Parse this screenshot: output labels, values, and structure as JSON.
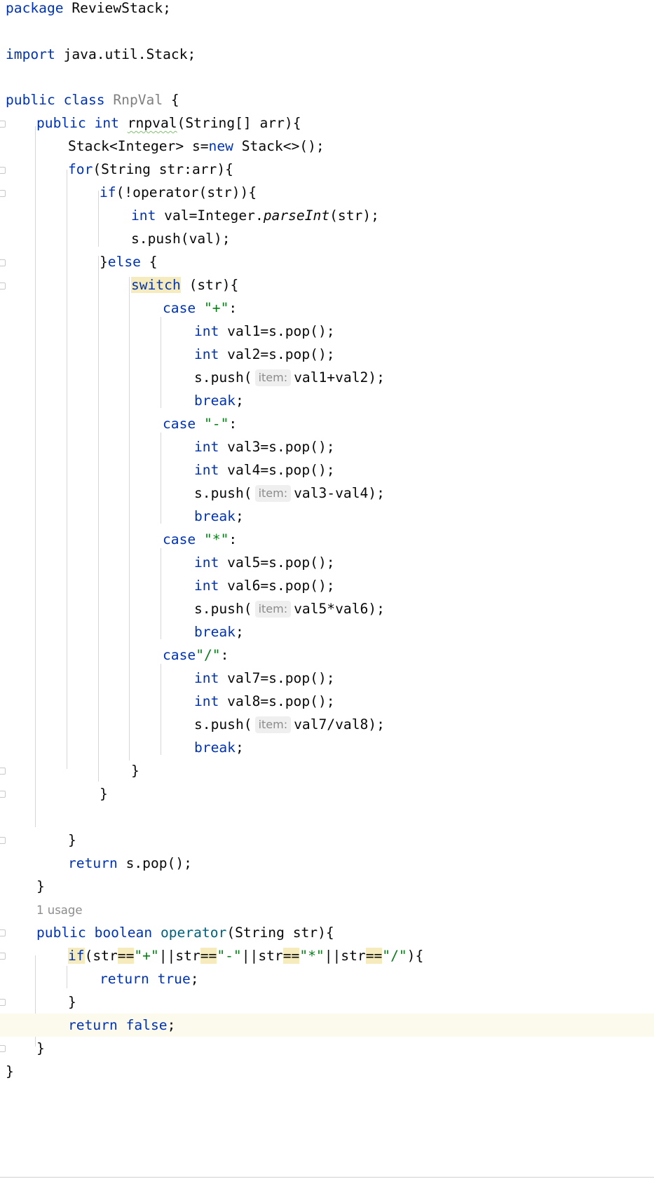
{
  "file": {
    "package_kw": "package",
    "package_name": " ReviewStack;",
    "import_kw": "import",
    "import_name": " java.util.Stack;"
  },
  "class_decl": {
    "kw_public": "public",
    "kw_class": "class",
    "name": "RnpVal",
    "brace": " {"
  },
  "method_rnpval": {
    "kw_public": "public",
    "kw_int": "int",
    "name": "rnpval",
    "params": "(String[] arr){",
    "stack_decl_a": "Stack<Integer> s=",
    "kw_new": "new",
    "stack_decl_b": " Stack<>();",
    "kw_for": "for",
    "for_rest": "(String str:arr){",
    "kw_if": "if",
    "if_rest": "(!operator(str)){",
    "kw_int2": "int",
    "parse_a": " val=Integer.",
    "parse_method": "parseInt",
    "parse_b": "(str);",
    "push_val": "s.push(val);",
    "else_a": "}",
    "kw_else": "else",
    "else_b": " {",
    "kw_switch": "switch",
    "switch_rest": " (str){",
    "close_switch": "}",
    "close_else": "}",
    "close_for": "}",
    "kw_return": "return",
    "return_rest": " s.pop();",
    "close_method": "}"
  },
  "cases": [
    {
      "kw_case": "case",
      "gap": " ",
      "literal": "\"+\"",
      "colon": ":",
      "pop1": " val1=s.pop();",
      "pop2": " val2=s.pop();",
      "push_a": "s.push(",
      "hint": "item:",
      "push_b": "val1+val2);",
      "kw_break": "break",
      "semi": ";"
    },
    {
      "kw_case": "case",
      "gap": " ",
      "literal": "\"-\"",
      "colon": ":",
      "pop1": " val3=s.pop();",
      "pop2": " val4=s.pop();",
      "push_a": "s.push(",
      "hint": "item:",
      "push_b": "val3-val4);",
      "kw_break": "break",
      "semi": ";"
    },
    {
      "kw_case": "case",
      "gap": " ",
      "literal": "\"*\"",
      "colon": ":",
      "pop1": " val5=s.pop();",
      "pop2": " val6=s.pop();",
      "push_a": "s.push(",
      "hint": "item:",
      "push_b": "val5*val6);",
      "kw_break": "break",
      "semi": ";"
    },
    {
      "kw_case": "case",
      "gap": "",
      "literal": "\"/\"",
      "colon": ":",
      "pop1": " val7=s.pop();",
      "pop2": " val8=s.pop();",
      "push_a": "s.push(",
      "hint": "item:",
      "push_b": "val7/val8);",
      "kw_break": "break",
      "semi": ";"
    }
  ],
  "kw_int": "int",
  "usage_hint": "1 usage",
  "method_operator": {
    "kw_public": "public",
    "kw_boolean": "boolean",
    "name": "operator",
    "params": "(String str){",
    "kw_if": "if",
    "cond": {
      "open": "(str",
      "eq": "==",
      "lit_plus": "\"+\"",
      "or1": "||str",
      "lit_minus": "\"-\"",
      "or2": "||str",
      "lit_star": "\"*\"",
      "or3": "||str",
      "lit_slash": "\"/\"",
      "close": "){"
    },
    "kw_return": "return",
    "kw_true": "true",
    "kw_false": "false",
    "semi": ";",
    "close_if": "}",
    "close_method": "}"
  },
  "close_class": "}"
}
